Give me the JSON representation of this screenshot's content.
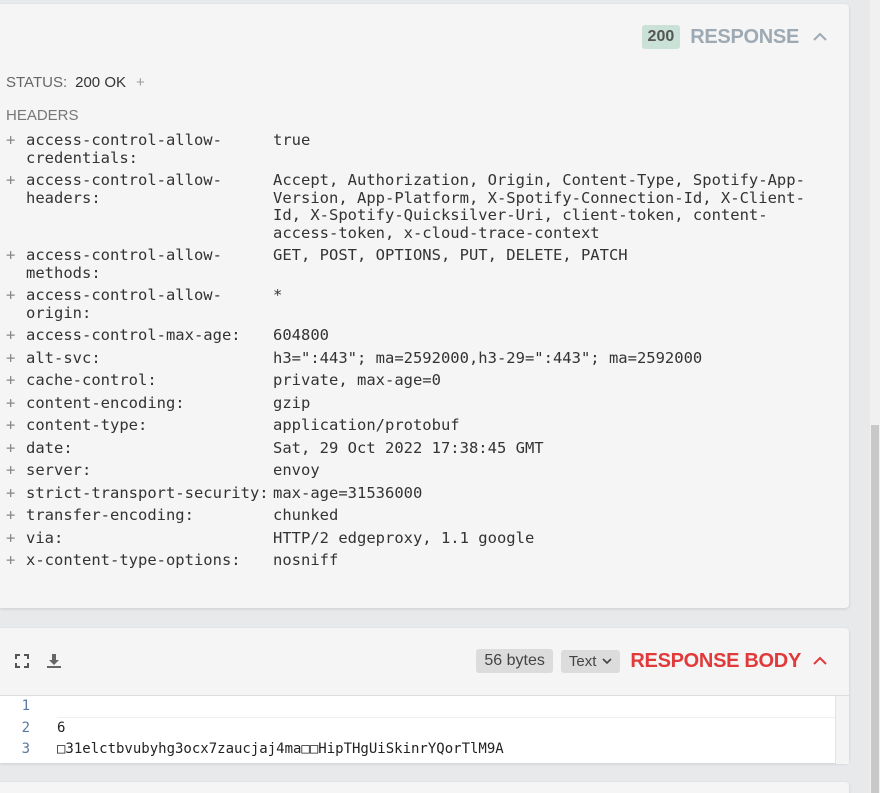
{
  "response": {
    "status_code": "200",
    "title": "RESPONSE",
    "status_label": "STATUS:",
    "status_value": "200 OK",
    "plus": "+",
    "headers_label": "HEADERS",
    "headers": [
      {
        "key": "access-control-allow-credentials:",
        "value": "true"
      },
      {
        "key": "access-control-allow-headers:",
        "value": "Accept, Authorization, Origin, Content-Type, Spotify-App-Version, App-Platform, X-Spotify-Connection-Id, X-Client-Id, X-Spotify-Quicksilver-Uri, client-token, content-access-token, x-cloud-trace-context"
      },
      {
        "key": "access-control-allow-methods:",
        "value": "GET, POST, OPTIONS, PUT, DELETE, PATCH"
      },
      {
        "key": "access-control-allow-origin:",
        "value": "*"
      },
      {
        "key": "access-control-max-age:",
        "value": "604800"
      },
      {
        "key": "alt-svc:",
        "value": "h3=\":443\"; ma=2592000,h3-29=\":443\"; ma=2592000"
      },
      {
        "key": "cache-control:",
        "value": "private, max-age=0"
      },
      {
        "key": "content-encoding:",
        "value": "gzip"
      },
      {
        "key": "content-type:",
        "value": "application/protobuf"
      },
      {
        "key": "date:",
        "value": "Sat, 29 Oct 2022 17:38:45 GMT"
      },
      {
        "key": "server:",
        "value": "envoy"
      },
      {
        "key": "strict-transport-security:",
        "value": "max-age=31536000"
      },
      {
        "key": "transfer-encoding:",
        "value": "chunked"
      },
      {
        "key": "via:",
        "value": "HTTP/2 edgeproxy, 1.1 google"
      },
      {
        "key": "x-content-type-options:",
        "value": "nosniff"
      }
    ]
  },
  "response_body": {
    "size": "56 bytes",
    "format": "Text",
    "title": "RESPONSE BODY",
    "lines": [
      {
        "num": "1",
        "text": ""
      },
      {
        "num": "2",
        "text": "6"
      },
      {
        "num": "3",
        "text": "□31elctbvubyhg3ocx7zaucjaj4ma□□HipTHgUiSkinrYQorTlM9A"
      }
    ]
  },
  "colors": {
    "status_pill": "#c9e1d7",
    "response_title": "#9eaab3",
    "response_body_title": "#e03a3a"
  }
}
